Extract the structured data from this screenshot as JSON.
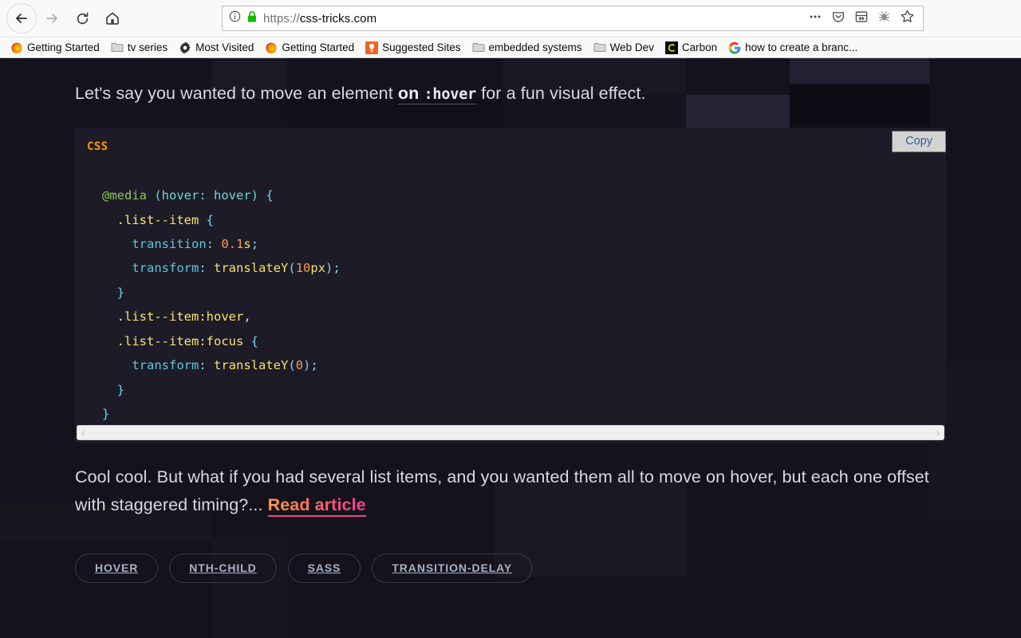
{
  "browser": {
    "nav": {
      "back": "Back",
      "forward": "Forward",
      "reload": "Reload",
      "home": "Home"
    },
    "urlbar": {
      "scheme": "https://",
      "host": "css-tricks.com",
      "full_url": "https://css-tricks.com",
      "identity_icon": "info-icon",
      "lock_icon": "padlock-icon"
    },
    "toolbar_icons": [
      {
        "name": "page-actions-icon",
        "glyph": "•••"
      },
      {
        "name": "pocket-icon",
        "glyph": "shield"
      },
      {
        "name": "container-tabs-icon",
        "glyph": "container"
      },
      {
        "name": "bug-icon",
        "glyph": "bug"
      },
      {
        "name": "bookmark-star-icon",
        "glyph": "star"
      }
    ],
    "bookmarks": [
      {
        "label": "Getting Started",
        "icon": "firefox-icon"
      },
      {
        "label": "tv series",
        "icon": "folder-icon"
      },
      {
        "label": "Most Visited",
        "icon": "gear-icon"
      },
      {
        "label": "Getting Started",
        "icon": "firefox-icon"
      },
      {
        "label": "Suggested Sites",
        "icon": "lightbulb-icon"
      },
      {
        "label": "embedded systems",
        "icon": "folder-icon"
      },
      {
        "label": "Web Dev",
        "icon": "folder-icon"
      },
      {
        "label": "Carbon",
        "icon": "carbon-icon"
      },
      {
        "label": "how to create a branc...",
        "icon": "google-icon"
      }
    ]
  },
  "page": {
    "intro": {
      "before_link": "Let's say you wanted to move an element ",
      "link_word": "on ",
      "link_code": ":hover",
      "after_link": " for a fun visual effect."
    },
    "code": {
      "language_label": "CSS",
      "copy_label": "Copy",
      "scroll_left_glyph": "‹",
      "scroll_right_glyph": "›",
      "source": "@media (hover: hover) {\n  .list--item {\n    transition: 0.1s;\n    transform: translateY(10px);\n  }\n  .list--item:hover,\n  .list--item:focus {\n    transform: translateY(0);\n  }\n}",
      "lines": [
        "@media (hover: hover) {",
        "  .list--item {",
        "    transition: 0.1s;",
        "    transform: translateY(10px);",
        "  }",
        "  .list--item:hover,",
        "  .list--item:focus {",
        "    transform: translateY(0);",
        "  }",
        "}"
      ]
    },
    "outro": {
      "text": "Cool cool. But what if you had several list items, and you wanted them all to move on hover, but each one offset with staggered timing?... ",
      "link_label": "Read article"
    },
    "tags": [
      "HOVER",
      "NTH-CHILD",
      "SASS",
      "TRANSITION-DELAY"
    ]
  },
  "colors": {
    "page_background": "#14121c",
    "code_background": "#1d1b27",
    "code_lang_accent": "#ff9800",
    "link_gradient_start": "#ff9b3f",
    "link_gradient_end": "#f5428f",
    "tag_border": "#3b3947",
    "body_text": "#d9d9e3"
  }
}
